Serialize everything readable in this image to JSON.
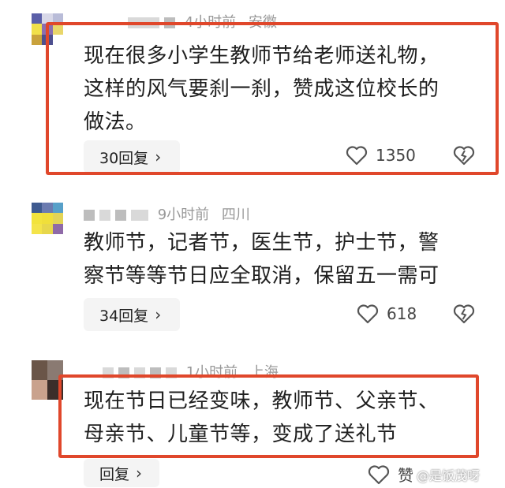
{
  "comments": [
    {
      "time": "4小时前",
      "location": "安徽",
      "lines": [
        "现在很多小学生教师节给老师送礼物，",
        "这样的风气要刹一刹，赞成这位校长的",
        "做法。"
      ],
      "reply_label": "30回复",
      "likes": "1350"
    },
    {
      "time": "9小时前",
      "location": "四川",
      "lines": [
        "教师节，记者节，医生节，护士节，警",
        "察节等等节日应全取消，保留五一需可"
      ],
      "reply_label": "34回复",
      "likes": "618"
    },
    {
      "time": "1小时前",
      "location": "上海",
      "lines": [
        "现在节日已经变味，教师节、父亲节、",
        "母亲节、儿童节等，变成了送礼节"
      ],
      "reply_label": "回复",
      "likes": "赞"
    }
  ],
  "watermark": "@是饭茂呀",
  "colors": {
    "highlight": "#e0472b",
    "reply_bg": "#f4f4f4",
    "meta": "#999999"
  },
  "icons": {
    "like": "heart-outline-icon",
    "dislike": "broken-heart-icon",
    "chevron": "chevron-right-icon"
  }
}
